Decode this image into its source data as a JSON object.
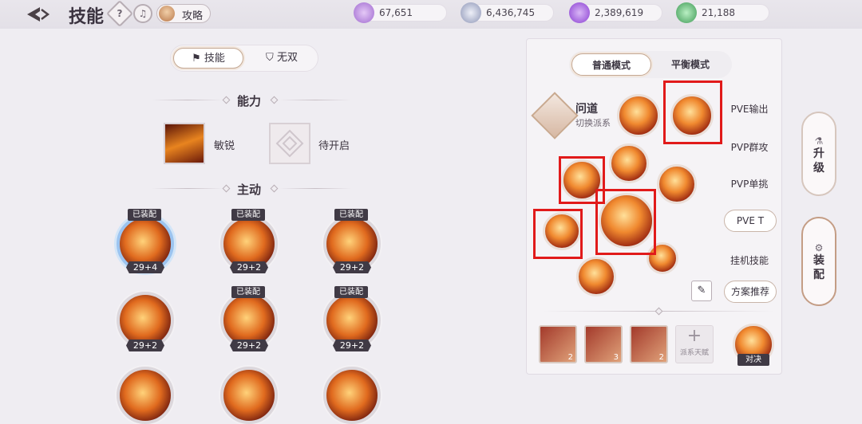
{
  "header": {
    "title": "技能",
    "help": "?",
    "guide_label": "攻略"
  },
  "currencies": [
    {
      "icon": "purple-ticket-icon",
      "value": "67,651",
      "color": "#a06ad0"
    },
    {
      "icon": "silver-coin-icon",
      "value": "6,436,745",
      "color": "#8d95b6"
    },
    {
      "icon": "purple-gem-icon",
      "value": "2,389,619",
      "color": "#8a3fd2"
    },
    {
      "icon": "green-jade-icon",
      "value": "21,188",
      "color": "#3e9a55"
    }
  ],
  "tabs": [
    {
      "label": "技能",
      "active": true
    },
    {
      "label": "无双",
      "active": false
    }
  ],
  "sections": {
    "ability": "能力",
    "active": "主动"
  },
  "passives": [
    {
      "label": "敏锐"
    },
    {
      "label": "待开启"
    }
  ],
  "skills": [
    {
      "badge": "已装配",
      "level": "29+4",
      "selected": true
    },
    {
      "badge": "已装配",
      "level": "29+2",
      "selected": false
    },
    {
      "badge": "已装配",
      "level": "29+2",
      "selected": false
    },
    {
      "badge": "",
      "level": "29+2",
      "selected": false
    },
    {
      "badge": "已装配",
      "level": "29+2",
      "selected": false
    },
    {
      "badge": "已装配",
      "level": "29+2",
      "selected": false
    }
  ],
  "loadout": {
    "modes": [
      {
        "label": "普通模式",
        "active": true
      },
      {
        "label": "平衡模式",
        "active": false
      }
    ],
    "school_name": "问道",
    "school_switch": "切换派系",
    "presets": [
      "PVE输出",
      "PVP群攻",
      "PVP单挑",
      "PVE T",
      "挂机技能"
    ],
    "active_preset": "PVE T",
    "recommend_label": "方案推荐",
    "talents": [
      {
        "count": "2"
      },
      {
        "count": "3"
      },
      {
        "count": "2"
      }
    ],
    "add_talent_label": "派系天赋",
    "duel_label": "对决"
  },
  "right_nav": [
    {
      "label": "升级"
    },
    {
      "label": "装配"
    }
  ]
}
